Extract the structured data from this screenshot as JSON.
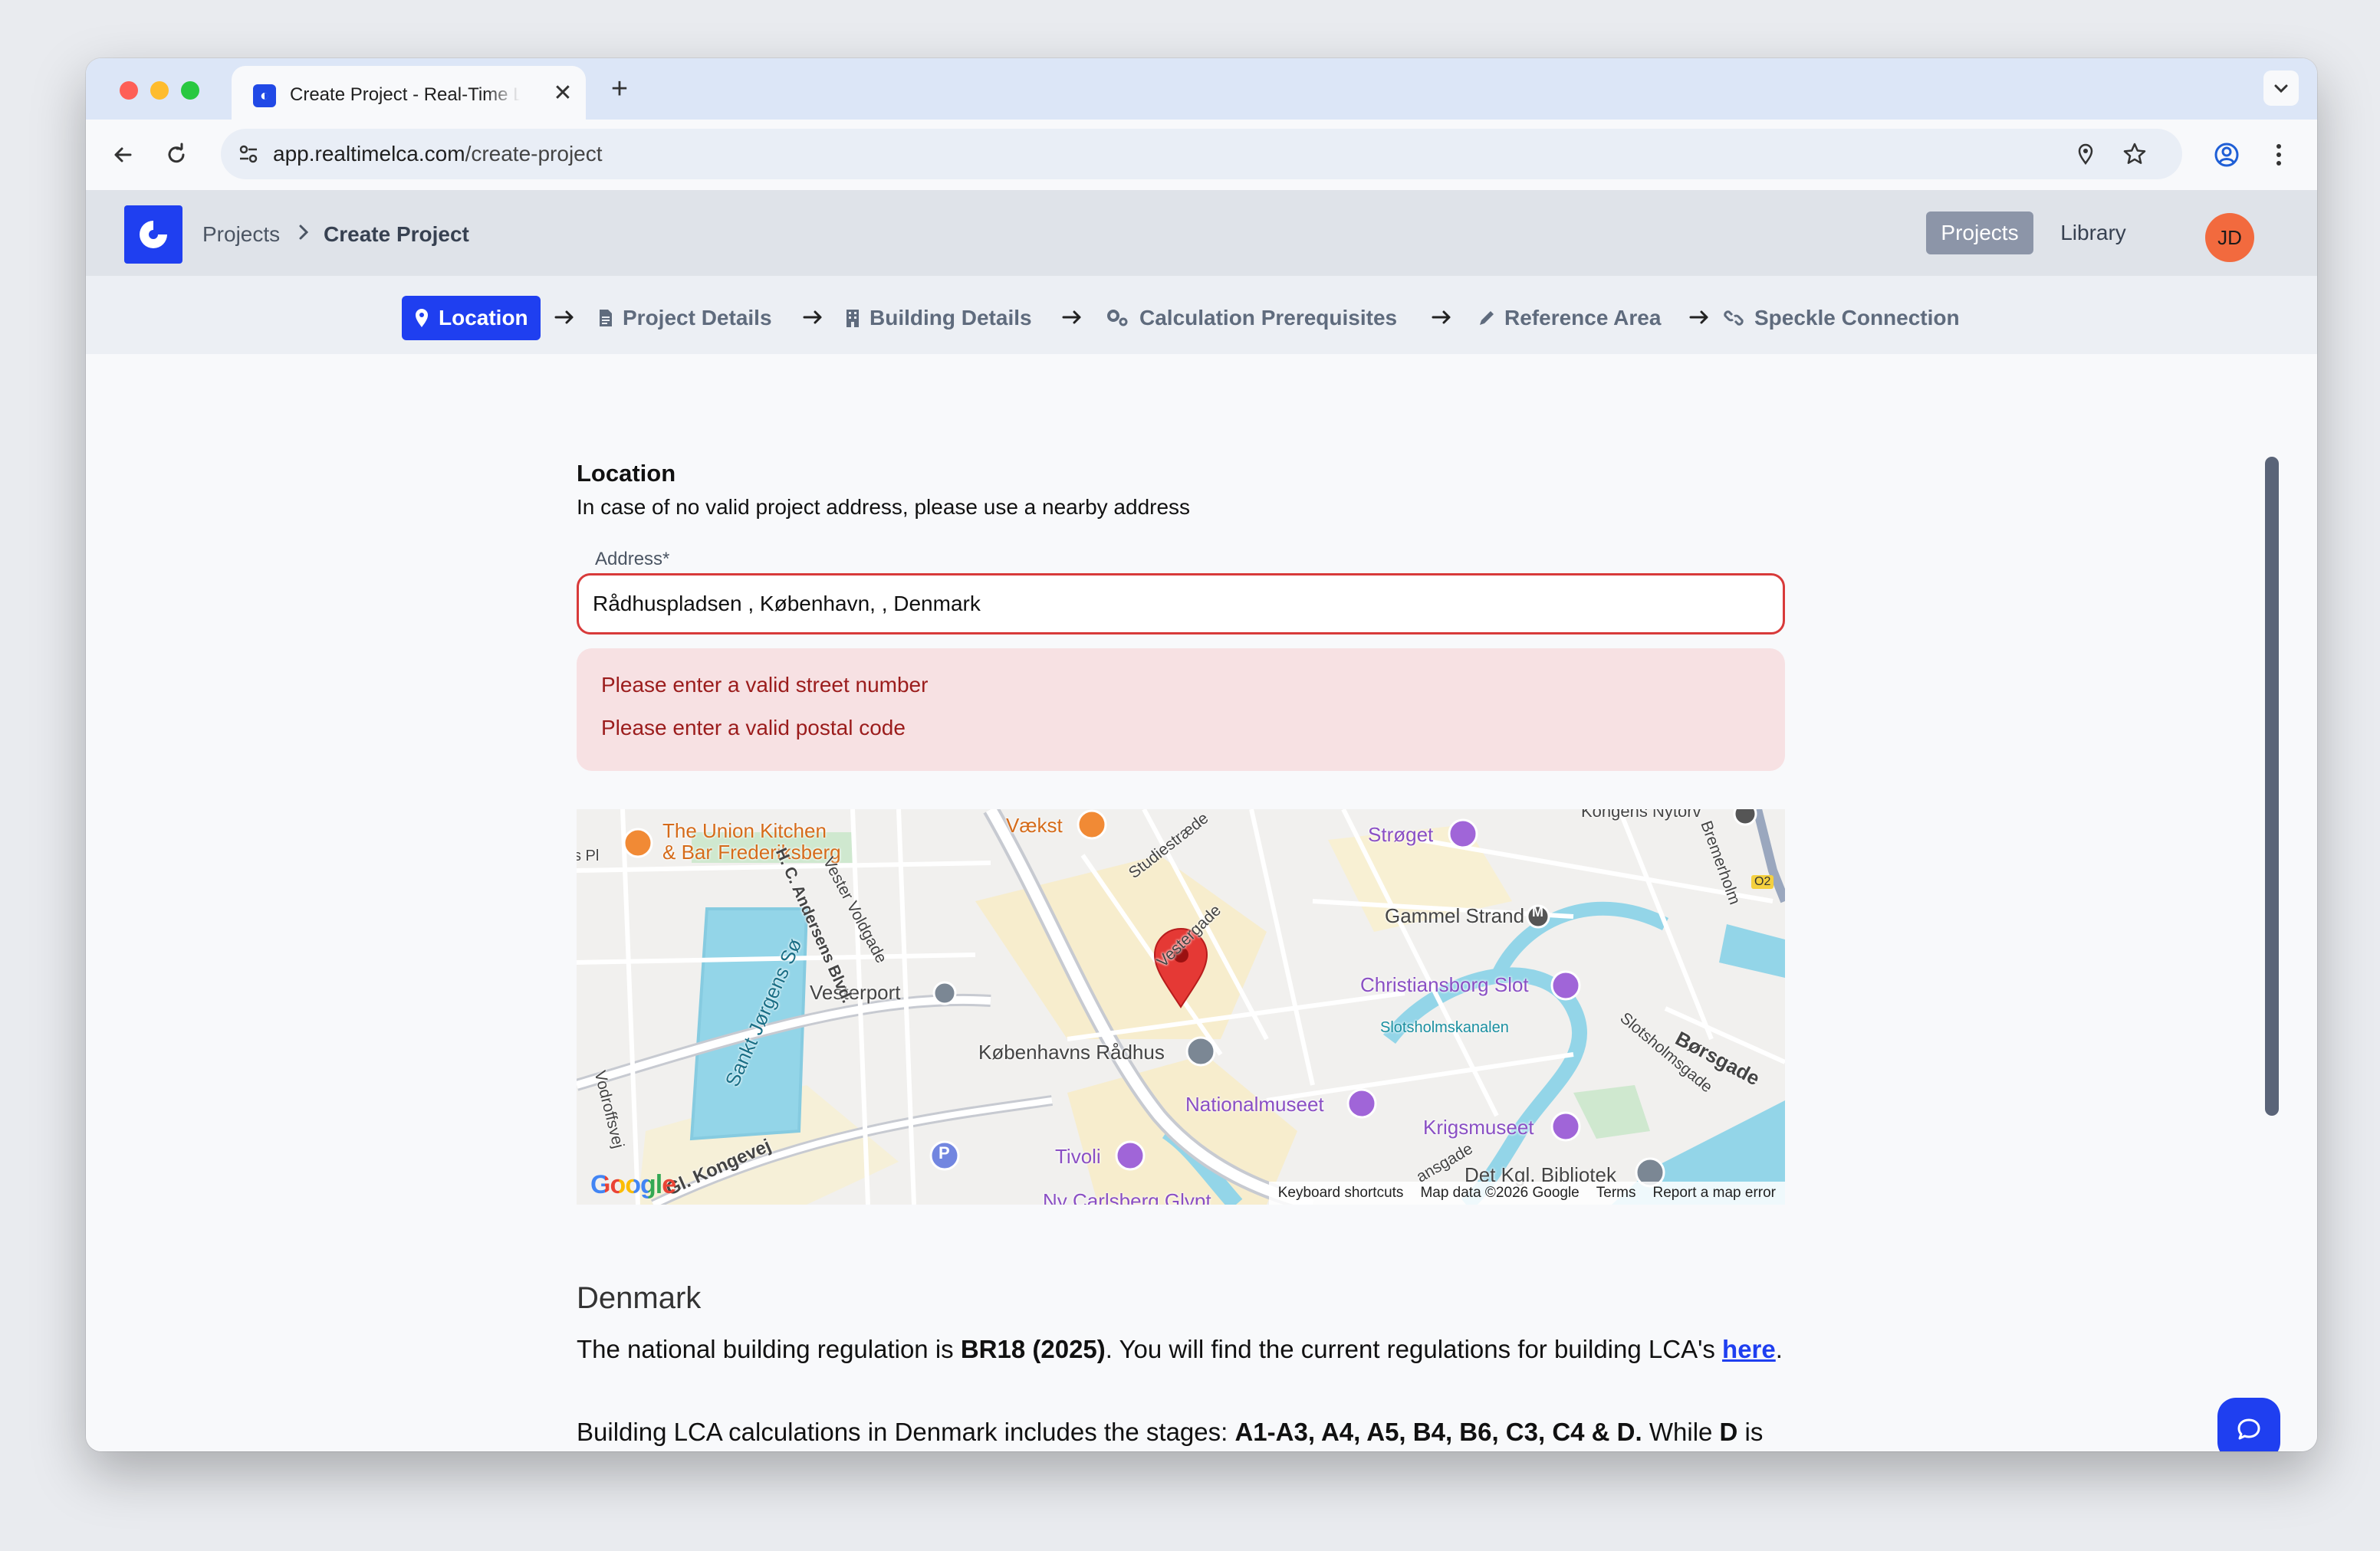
{
  "browser": {
    "tab_title": "Create Project - Real-Time LCA",
    "tab_close": "✕",
    "new_tab": "+",
    "url_host": "app.realtimelca.com",
    "url_path": "/create-project"
  },
  "header": {
    "breadcrumb_root": "Projects",
    "breadcrumb_current": "Create Project",
    "nav_projects": "Projects",
    "nav_library": "Library",
    "avatar_initials": "JD"
  },
  "steps": [
    {
      "label": "Location",
      "icon": "map-pin-icon",
      "active": true
    },
    {
      "label": "Project Details",
      "icon": "file-icon",
      "active": false
    },
    {
      "label": "Building Details",
      "icon": "building-icon",
      "active": false
    },
    {
      "label": "Calculation Prerequisites",
      "icon": "gears-icon",
      "active": false
    },
    {
      "label": "Reference Area",
      "icon": "pencil-icon",
      "active": false
    },
    {
      "label": "Speckle Connection",
      "icon": "link-icon",
      "active": false
    }
  ],
  "location": {
    "title": "Location",
    "subtitle": "In case of no valid project address, please use a nearby address",
    "address_label": "Address*",
    "address_value": "Rådhuspladsen , København, , Denmark",
    "errors": [
      "Please enter a valid street number",
      "Please enter a valid postal code"
    ]
  },
  "map": {
    "places": {
      "union_kitchen_1": "The Union Kitchen",
      "union_kitchen_2": "& Bar Frederiksberg",
      "vaekst": "Vækst",
      "stroget": "Strøget",
      "gammel_strand": "Gammel Strand",
      "christiansborg": "Christiansborg Slot",
      "slotsholmskanalen": "Slotsholmskanalen",
      "vesterport": "Vesterport",
      "raadhus": "Københavns Rådhus",
      "nationalmuseet": "Nationalmuseet",
      "krigsmuseet": "Krigsmuseet",
      "tivoli": "Tivoli",
      "bibliotek": "Det Kgl. Bibliotek",
      "carlsberg": "Ny Carlsberg Glypt",
      "kongens_nytorv": "Kongens Nytorv",
      "lake": "Sankt Jørgens Sø",
      "borsgade": "Børsgade",
      "edge_pl": "s Pl"
    },
    "streets": {
      "hc_andersens": "H. C. Andersens Blvd.",
      "vester_voldgade": "Vester Voldgade",
      "studiestraede": "Studiestræde",
      "vestergade": "Vestergade",
      "bremerholm": "Bremerholm",
      "slotsholmsgade": "Slotsholmsgade",
      "vodroffsvej": "Vodroffsvej",
      "gl_kongevej": "Gl. Kongevej",
      "ansgade": "ansgade"
    },
    "metro_badge": "M",
    "route_badge": "O2",
    "parking_badge": "P",
    "google": "Google",
    "footer": {
      "shortcuts": "Keyboard shortcuts",
      "data": "Map data ©2026 Google",
      "terms": "Terms",
      "report": "Report a map error"
    }
  },
  "country": {
    "name": "Denmark",
    "p1_a": "The national building regulation is ",
    "p1_b": "BR18 (2025)",
    "p1_c": ". You will find the current regulations for building LCA's ",
    "p1_link": "here",
    "p1_d": ".",
    "p2_a": "Building LCA calculations in Denmark includes the stages: ",
    "p2_b": "A1-A3, A4, A5, B4, B6, C3, C4 & D.",
    "p2_c": " While ",
    "p2_d": "D",
    "p2_e": " is not a part of the result but needs to be visual."
  },
  "colors": {
    "accent": "#1f3ff0",
    "error_text": "#9b1c1c",
    "error_bg": "#f7e1e3",
    "avatar": "#f26a3e"
  }
}
